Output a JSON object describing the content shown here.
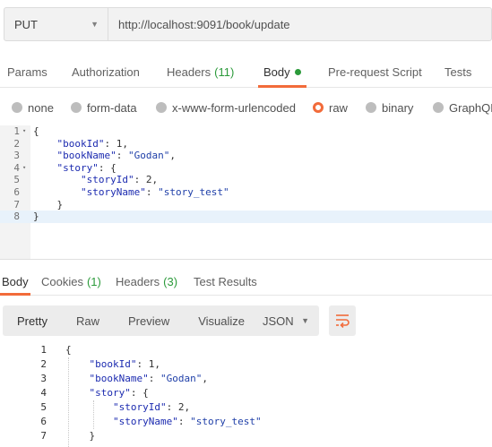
{
  "request": {
    "method": "PUT",
    "url": "http://localhost:9091/book/update"
  },
  "request_tabs": [
    {
      "label": "Params"
    },
    {
      "label": "Authorization"
    },
    {
      "label": "Headers",
      "count": "(11)"
    },
    {
      "label": "Body",
      "active": true
    },
    {
      "label": "Pre-request Script"
    },
    {
      "label": "Tests"
    }
  ],
  "body_types": [
    "none",
    "form-data",
    "x-www-form-urlencoded",
    "raw",
    "binary",
    "GraphQL"
  ],
  "body_type_selected": "raw",
  "request_body_lines": [
    {
      "n": "1",
      "fold": "▾",
      "code": "{"
    },
    {
      "n": "2",
      "code": "    \"bookId\": 1,"
    },
    {
      "n": "3",
      "code": "    \"bookName\": \"Godan\","
    },
    {
      "n": "4",
      "fold": "▾",
      "code": "    \"story\": {"
    },
    {
      "n": "5",
      "code": "        \"storyId\": 2,"
    },
    {
      "n": "6",
      "code": "        \"storyName\": \"story_test\""
    },
    {
      "n": "7",
      "code": "    }"
    },
    {
      "n": "8",
      "code": "}"
    }
  ],
  "response_tabs": [
    {
      "label": "Body",
      "active": true
    },
    {
      "label": "Cookies",
      "count": "(1)"
    },
    {
      "label": "Headers",
      "count": "(3)"
    },
    {
      "label": "Test Results"
    }
  ],
  "view_modes": [
    "Pretty",
    "Raw",
    "Preview",
    "Visualize"
  ],
  "view_mode_selected": "Pretty",
  "format": "JSON",
  "response_body_lines": [
    {
      "n": "1",
      "code": "{"
    },
    {
      "n": "2",
      "code": "    \"bookId\": 1,"
    },
    {
      "n": "3",
      "code": "    \"bookName\": \"Godan\","
    },
    {
      "n": "4",
      "code": "    \"story\": {"
    },
    {
      "n": "5",
      "code": "        \"storyId\": 2,"
    },
    {
      "n": "6",
      "code": "        \"storyName\": \"story_test\""
    },
    {
      "n": "7",
      "code": "    }"
    }
  ],
  "colors": {
    "accent": "#f26b3a",
    "count": "#2b9a3a"
  }
}
